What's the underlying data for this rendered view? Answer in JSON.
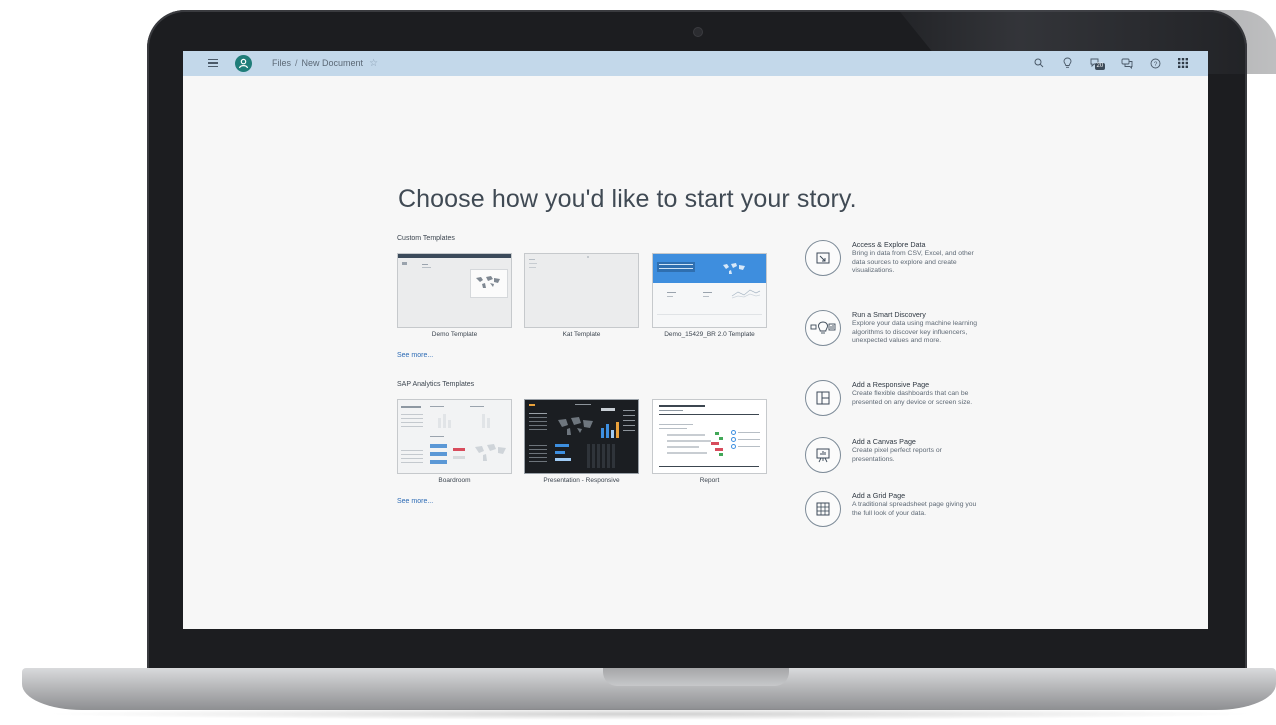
{
  "shellbar": {
    "breadcrumb_root": "Files",
    "breadcrumb_separator": "/",
    "breadcrumb_current": "New Document",
    "favorite_star": "☆",
    "icons": [
      "search-icon",
      "lightbulb-icon",
      "notifications-icon",
      "feedback-icon",
      "help-icon",
      "app-grid-icon"
    ],
    "notification_count": "20",
    "bar_color": "#c3d8ea",
    "avatar_color": "#1f7d79"
  },
  "main": {
    "headline": "Choose how you'd like to start your story.",
    "custom_templates": {
      "heading": "Custom Templates",
      "tiles": [
        {
          "label": "Demo Template"
        },
        {
          "label": "Kat Template"
        },
        {
          "label": "Demo_15429_BR 2.0 Template"
        }
      ],
      "see_more": "See more..."
    },
    "sap_templates": {
      "heading": "SAP Analytics Templates",
      "tiles": [
        {
          "label": "Boardroom"
        },
        {
          "label": "Presentation - Responsive"
        },
        {
          "label": "Report"
        }
      ],
      "see_more": "See more..."
    },
    "options": [
      {
        "title": "Access & Explore Data",
        "description": "Bring in data from CSV, Excel, and other data sources to explore and create visualizations.",
        "icon": "import-data-icon"
      },
      {
        "title": "Run a Smart Discovery",
        "description": "Explore your data using machine learning algorithms to discover key influencers, unexpected values and more.",
        "icon": "smart-discovery-icon"
      },
      {
        "title": "Add a Responsive Page",
        "description": "Create flexible dashboards that can be presented on any device or screen size.",
        "icon": "responsive-page-icon"
      },
      {
        "title": "Add a Canvas Page",
        "description": "Create pixel perfect reports or presentations.",
        "icon": "canvas-page-icon"
      },
      {
        "title": "Add a Grid Page",
        "description": "A traditional spreadsheet page giving you the full look of your data.",
        "icon": "grid-page-icon"
      }
    ],
    "accent_color": "#2d6bb5"
  }
}
